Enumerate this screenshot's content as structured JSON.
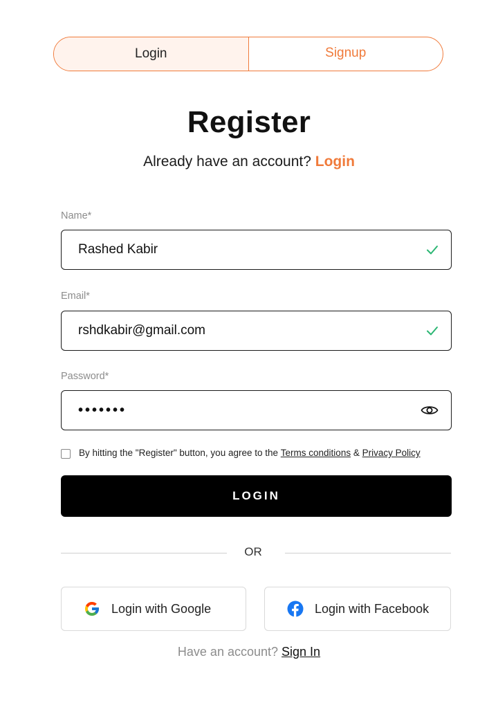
{
  "tabs": {
    "login_label": "Login",
    "signup_label": "Signup"
  },
  "header": {
    "title": "Register",
    "subtitle_text": "Already have an account?",
    "subtitle_link": "Login"
  },
  "form": {
    "name": {
      "label": "Name*",
      "value": "Rashed Kabir",
      "status_icon": "check-icon"
    },
    "email": {
      "label": "Email*",
      "value": "rshdkabir@gmail.com",
      "status_icon": "check-icon"
    },
    "password": {
      "label": "Password*",
      "value": "•••••••",
      "toggle_icon": "eye-icon"
    },
    "agreement": {
      "text": "By hitting the \"Register\" button, you agree to the",
      "terms_link": "Terms conditions",
      "ampersand": "&",
      "privacy_link": "Privacy Policy",
      "checked": false
    },
    "submit_label": "LOGIN"
  },
  "divider": {
    "label": "OR"
  },
  "social": {
    "google_label": "Login with Google",
    "facebook_label": "Login with Facebook"
  },
  "footer": {
    "text": "Have an account?",
    "link": "Sign In"
  },
  "colors": {
    "accent": "#f07a3a",
    "success": "#2bb673",
    "button_bg": "#000000",
    "facebook": "#1877f2"
  }
}
